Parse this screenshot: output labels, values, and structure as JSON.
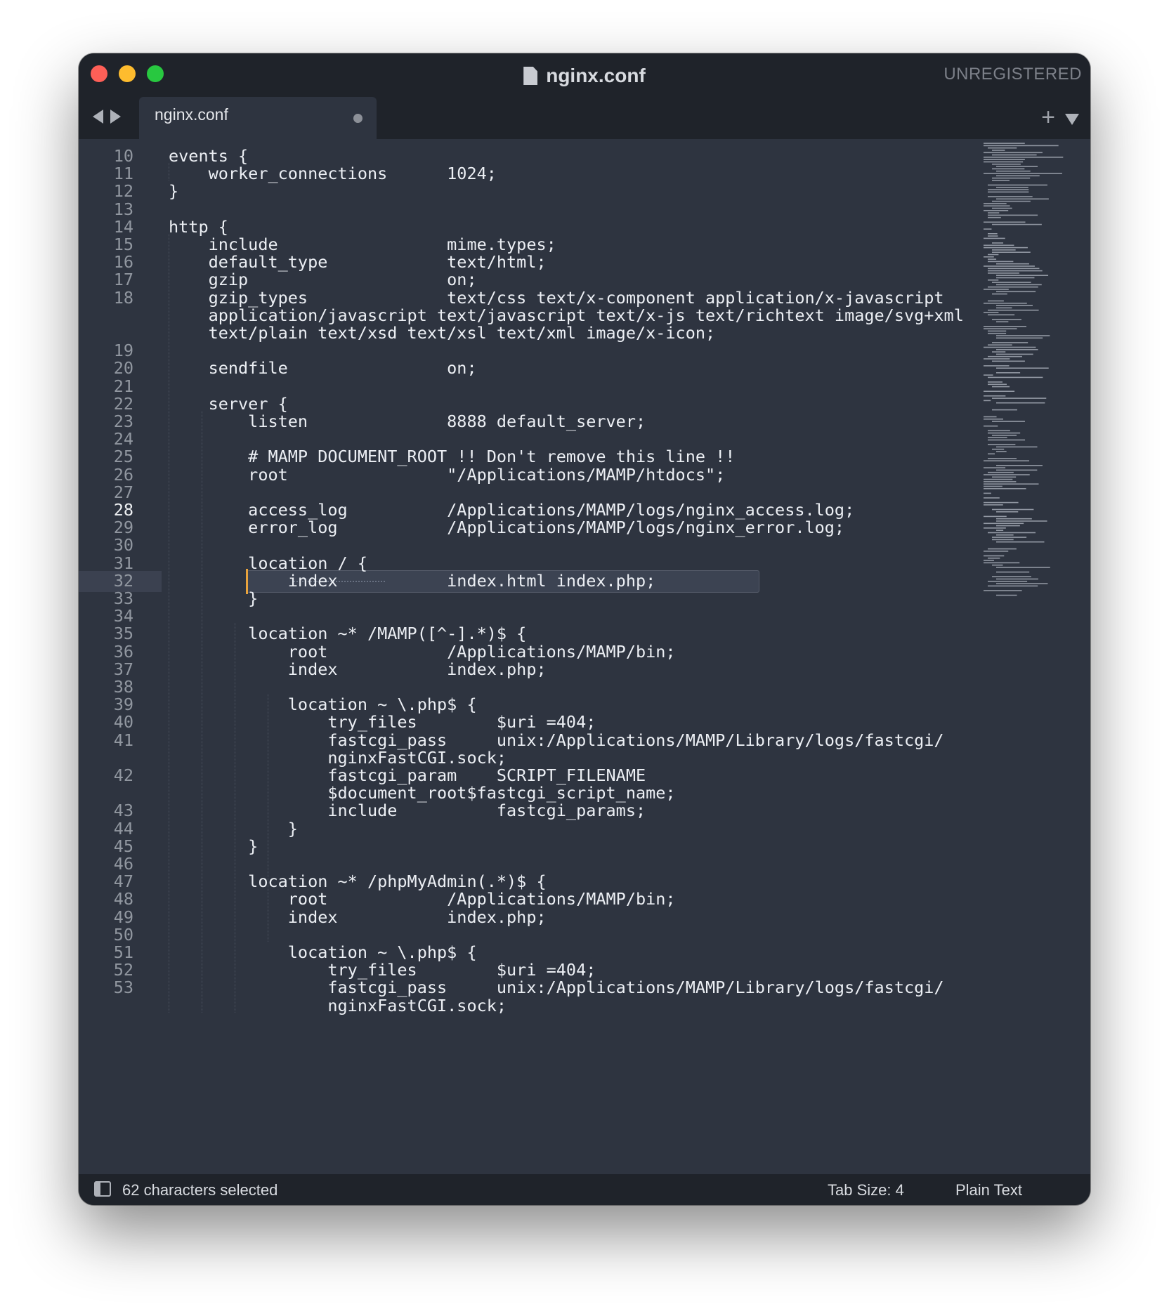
{
  "window": {
    "title": "nginx.conf",
    "unregistered_label": "UNREGISTERED"
  },
  "tab": {
    "label": "nginx.conf",
    "modified": true
  },
  "icons": {
    "close": "close-window-icon",
    "minimize": "minimize-window-icon",
    "maximize": "maximize-window-icon",
    "document": "document-icon",
    "back": "chevron-left-icon",
    "forward": "chevron-right-icon",
    "new_tab": "plus-icon",
    "tab_menu": "triangle-down-icon",
    "panel": "sidebar-panel-icon"
  },
  "colors": {
    "editor_bg": "#2e3440",
    "chrome_bg": "#1f232a",
    "caret": "#e8a33d",
    "close": "#fe5f57",
    "minimize": "#febc2e",
    "maximize": "#28c840"
  },
  "editor": {
    "current_line": "28",
    "lines": [
      {
        "n": "10",
        "text": "events {"
      },
      {
        "n": "11",
        "text": "    worker_connections      1024;"
      },
      {
        "n": "12",
        "text": "}"
      },
      {
        "n": "13",
        "text": ""
      },
      {
        "n": "14",
        "text": "http {"
      },
      {
        "n": "15",
        "text": "    include                 mime.types;"
      },
      {
        "n": "16",
        "text": "    default_type            text/html;"
      },
      {
        "n": "17",
        "text": "    gzip                    on;"
      },
      {
        "n": "18",
        "text": "    gzip_types              text/css text/x-component application/x-javascript"
      },
      {
        "n": "",
        "text": "    application/javascript text/javascript text/x-js text/richtext image/svg+xml"
      },
      {
        "n": "",
        "text": "    text/plain text/xsd text/xsl text/xml image/x-icon;"
      },
      {
        "n": "19",
        "text": ""
      },
      {
        "n": "20",
        "text": "    sendfile                on;"
      },
      {
        "n": "21",
        "text": ""
      },
      {
        "n": "22",
        "text": "    server {"
      },
      {
        "n": "23",
        "text": "        listen              8888 default_server;"
      },
      {
        "n": "24",
        "text": ""
      },
      {
        "n": "25",
        "text": "        # MAMP DOCUMENT_ROOT !! Don't remove this line !!"
      },
      {
        "n": "26",
        "text": "        root                \"/Applications/MAMP/htdocs\";"
      },
      {
        "n": "27",
        "text": ""
      },
      {
        "n": "28",
        "text": "        access_log          /Applications/MAMP/logs/nginx_access.log;"
      },
      {
        "n": "29",
        "text": "        error_log           /Applications/MAMP/logs/nginx_error.log;"
      },
      {
        "n": "30",
        "text": ""
      },
      {
        "n": "31",
        "text": "        location / {"
      },
      {
        "n": "32",
        "text": "            index           index.html index.php;"
      },
      {
        "n": "33",
        "text": "        }"
      },
      {
        "n": "34",
        "text": ""
      },
      {
        "n": "35",
        "text": "        location ~* /MAMP([^-].*)$ {"
      },
      {
        "n": "36",
        "text": "            root            /Applications/MAMP/bin;"
      },
      {
        "n": "37",
        "text": "            index           index.php;"
      },
      {
        "n": "38",
        "text": ""
      },
      {
        "n": "39",
        "text": "            location ~ \\.php$ {"
      },
      {
        "n": "40",
        "text": "                try_files        $uri =404;"
      },
      {
        "n": "41",
        "text": "                fastcgi_pass     unix:/Applications/MAMP/Library/logs/fastcgi/"
      },
      {
        "n": "",
        "text": "                nginxFastCGI.sock;"
      },
      {
        "n": "42",
        "text": "                fastcgi_param    SCRIPT_FILENAME"
      },
      {
        "n": "",
        "text": "                $document_root$fastcgi_script_name;"
      },
      {
        "n": "43",
        "text": "                include          fastcgi_params;"
      },
      {
        "n": "44",
        "text": "            }"
      },
      {
        "n": "45",
        "text": "        }"
      },
      {
        "n": "46",
        "text": ""
      },
      {
        "n": "47",
        "text": "        location ~* /phpMyAdmin(.*)$ {"
      },
      {
        "n": "48",
        "text": "            root            /Applications/MAMP/bin;"
      },
      {
        "n": "49",
        "text": "            index           index.php;"
      },
      {
        "n": "50",
        "text": ""
      },
      {
        "n": "51",
        "text": "            location ~ \\.php$ {"
      },
      {
        "n": "52",
        "text": "                try_files        $uri =404;"
      },
      {
        "n": "53",
        "text": "                fastcgi_pass     unix:/Applications/MAMP/Library/logs/fastcgi/"
      },
      {
        "n": "",
        "text": "                nginxFastCGI.sock;"
      }
    ]
  },
  "statusbar": {
    "selection": "62 characters selected",
    "tab_size": "Tab Size: 4",
    "syntax": "Plain Text"
  }
}
